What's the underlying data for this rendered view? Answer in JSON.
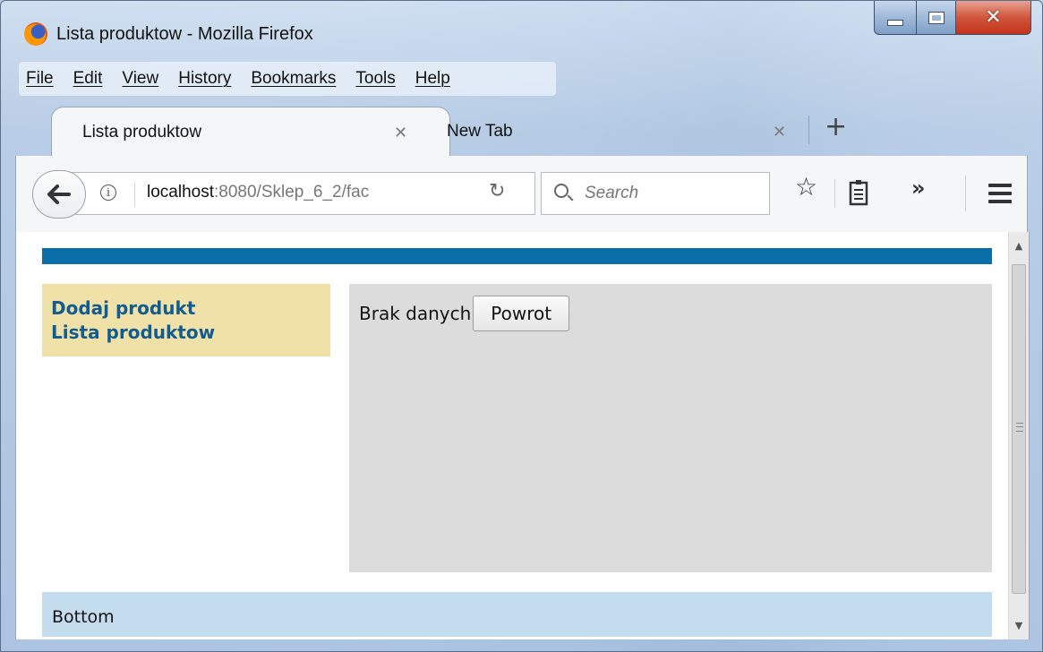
{
  "window": {
    "title": "Lista produktow - Mozilla Firefox",
    "app_icon": "firefox-icon"
  },
  "menubar": {
    "items": [
      "File",
      "Edit",
      "View",
      "History",
      "Bookmarks",
      "Tools",
      "Help"
    ]
  },
  "tabs": [
    {
      "label": "Lista produktow",
      "active": true
    },
    {
      "label": "New Tab",
      "active": false
    }
  ],
  "navbar": {
    "url_host": "localhost",
    "url_rest": ":8080/Sklep_6_2/fac",
    "search_placeholder": "Search"
  },
  "page": {
    "sidebar": {
      "links": [
        "Dodaj produkt",
        "Lista produktow"
      ]
    },
    "main": {
      "status_text": "Brak danych",
      "back_button_label": "Powrot"
    },
    "footer": {
      "text": "Bottom"
    },
    "colors": {
      "header_strip": "#0a6fa8",
      "sidebar_bg": "#efe1a8",
      "sidebar_link": "#125c8f",
      "main_bg": "#dcdcdc",
      "footer_bg": "#c3dcee"
    }
  }
}
